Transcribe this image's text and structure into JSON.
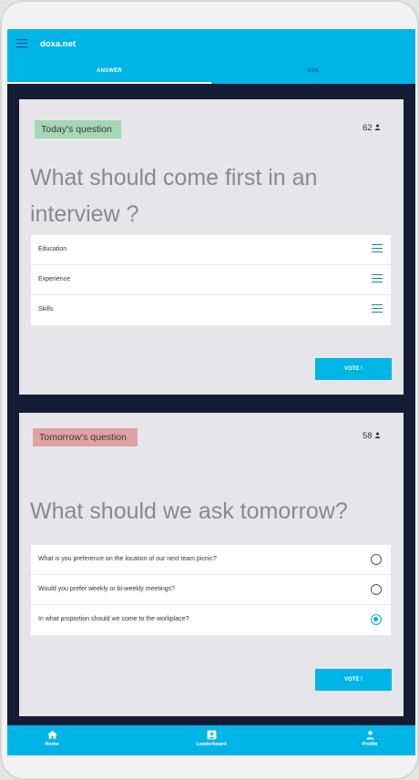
{
  "app": {
    "title": "doxa.net",
    "tabs": [
      "ANSWER",
      "ASK"
    ]
  },
  "today": {
    "badge": "Today's question",
    "count": "62",
    "question": "What should come first in an interview ?",
    "options": [
      "Education",
      "Experience",
      "Skills"
    ],
    "vote_label": "VOTE !"
  },
  "tomorrow": {
    "badge": "Tomorrow's question",
    "count": "58",
    "question": "What should we ask tomorrow?",
    "options": [
      {
        "label": "What is you preference on the location of our next team picnic?",
        "selected": false
      },
      {
        "label": "Would you prefer weekly or bi-weekly meetings?",
        "selected": false
      },
      {
        "label": "In what proportion should we come to the workplace?",
        "selected": true
      }
    ],
    "vote_label": "VOTE !"
  },
  "bottom_nav": {
    "home": "Home",
    "leaderboard": "Leaderboard",
    "profile": "Profile"
  },
  "colors": {
    "accent": "#00b4e8",
    "background": "#151d36",
    "card": "#e6e6ea",
    "today_badge": "#a4d7b5",
    "tomorrow_badge": "#e1a1a2"
  },
  "icons": {
    "menu": "menu-icon",
    "person": "person-icon",
    "drag": "drag-handle-icon",
    "home": "home-icon",
    "leaderboard": "leaderboard-icon",
    "profile": "profile-icon"
  }
}
